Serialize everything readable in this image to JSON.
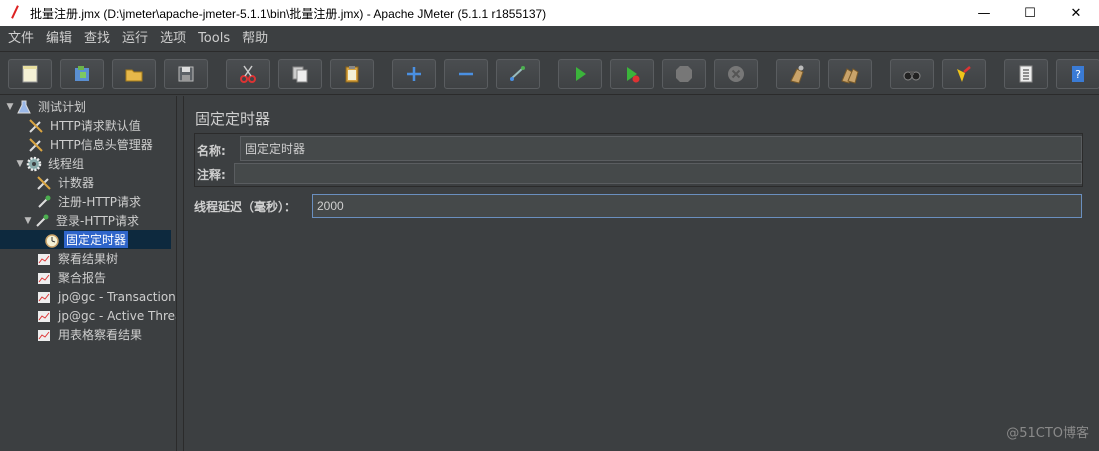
{
  "window": {
    "title": "批量注册.jmx (D:\\jmeter\\apache-jmeter-5.1.1\\bin\\批量注册.jmx) - Apache JMeter (5.1.1 r1855137)",
    "minimize_glyph": "—",
    "maximize_glyph": "☐",
    "close_glyph": "✕"
  },
  "menu": {
    "items": [
      "文件",
      "编辑",
      "查找",
      "运行",
      "选项",
      "Tools",
      "帮助"
    ]
  },
  "toolbar": {
    "buttons": [
      "new-icon",
      "templates-icon",
      "open-icon",
      "save-icon",
      "cut-icon",
      "copy-icon",
      "paste-icon",
      "expand-icon",
      "collapse-icon",
      "toggle-icon",
      "start-icon",
      "start-no-pauses-icon",
      "stop-icon",
      "shutdown-icon",
      "clear-icon",
      "clear-all-icon",
      "search-icon",
      "reset-search-icon",
      "function-helper-icon",
      "help-icon"
    ]
  },
  "tree": {
    "items": [
      {
        "label": "测试计划",
        "icon": "flask-icon"
      },
      {
        "label": "HTTP请求默认值",
        "icon": "wrench-icon"
      },
      {
        "label": "HTTP信息头管理器",
        "icon": "wrench-icon"
      },
      {
        "label": "线程组",
        "icon": "gear-icon"
      },
      {
        "label": "计数器",
        "icon": "wrench-icon"
      },
      {
        "label": "注册-HTTP请求",
        "icon": "pipette-icon"
      },
      {
        "label": "登录-HTTP请求",
        "icon": "pipette-icon"
      },
      {
        "label": "固定定时器",
        "icon": "stopwatch-icon"
      },
      {
        "label": "察看结果树",
        "icon": "graph-icon"
      },
      {
        "label": "聚合报告",
        "icon": "graph-icon"
      },
      {
        "label": "jp@gc - Transactions",
        "icon": "graph-icon"
      },
      {
        "label": "jp@gc - Active Threa",
        "icon": "graph-icon"
      },
      {
        "label": "用表格察看结果",
        "icon": "graph-icon"
      }
    ]
  },
  "content": {
    "title": "固定定时器",
    "name_label": "名称:",
    "name_value": "固定定时器",
    "comment_label": "注释:",
    "comment_value": "",
    "delay_label": "线程延迟（毫秒）：",
    "delay_value": "2000"
  },
  "watermark": "@51CTO博客"
}
